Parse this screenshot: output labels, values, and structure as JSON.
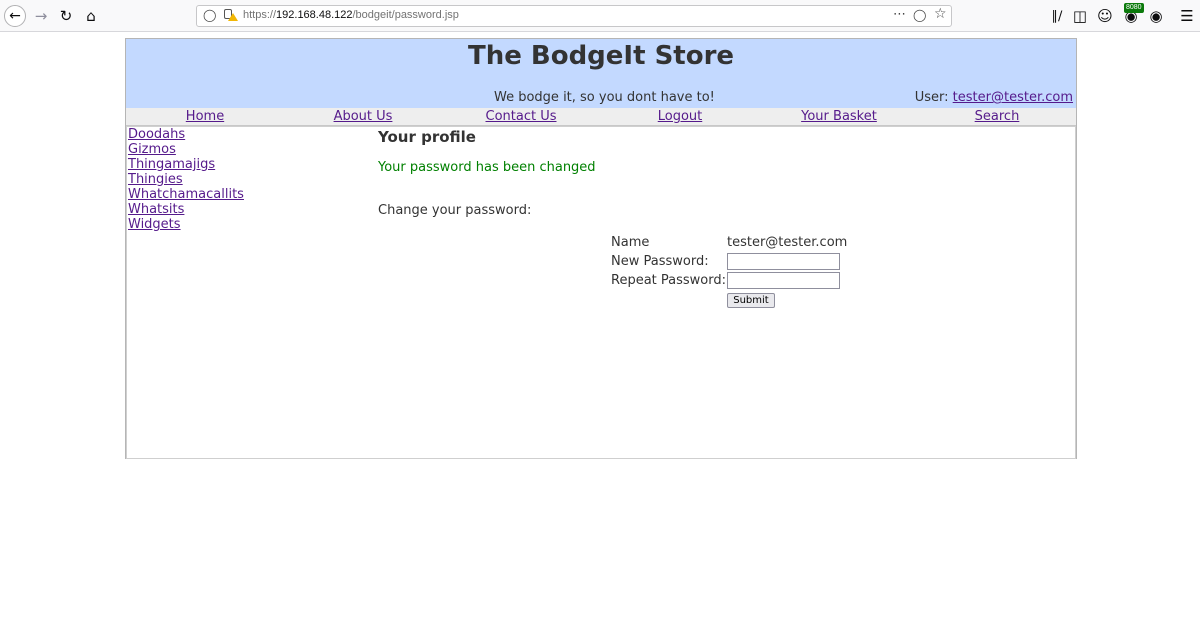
{
  "browser": {
    "url_prefix": "https://",
    "url_host": "192.168.48.122",
    "url_path": "/bodgeit/password.jsp",
    "extension_badge": "8080"
  },
  "store": {
    "title": "The BodgeIt Store",
    "tagline": "We bodge it, so you dont have to!",
    "user_label": "User:",
    "user_email": "tester@tester.com"
  },
  "nav": {
    "items": [
      "Home",
      "About Us",
      "Contact Us",
      "Logout",
      "Your Basket",
      "Search"
    ]
  },
  "sidebar": {
    "items": [
      "Doodahs",
      "Gizmos",
      "Thingamajigs",
      "Thingies",
      "Whatchamacallits",
      "Whatsits",
      "Widgets"
    ]
  },
  "main": {
    "heading": "Your profile",
    "success_message": "Your password has been changed",
    "change_label": "Change your password:",
    "form": {
      "name_label": "Name",
      "name_value": "tester@tester.com",
      "new_password_label": "New Password:",
      "new_password_value": "",
      "repeat_password_label": "Repeat Password:",
      "repeat_password_value": "",
      "submit_label": "Submit"
    }
  },
  "colors": {
    "banner": "#c3d9ff",
    "link": "#551a8b",
    "success": "#008000"
  }
}
